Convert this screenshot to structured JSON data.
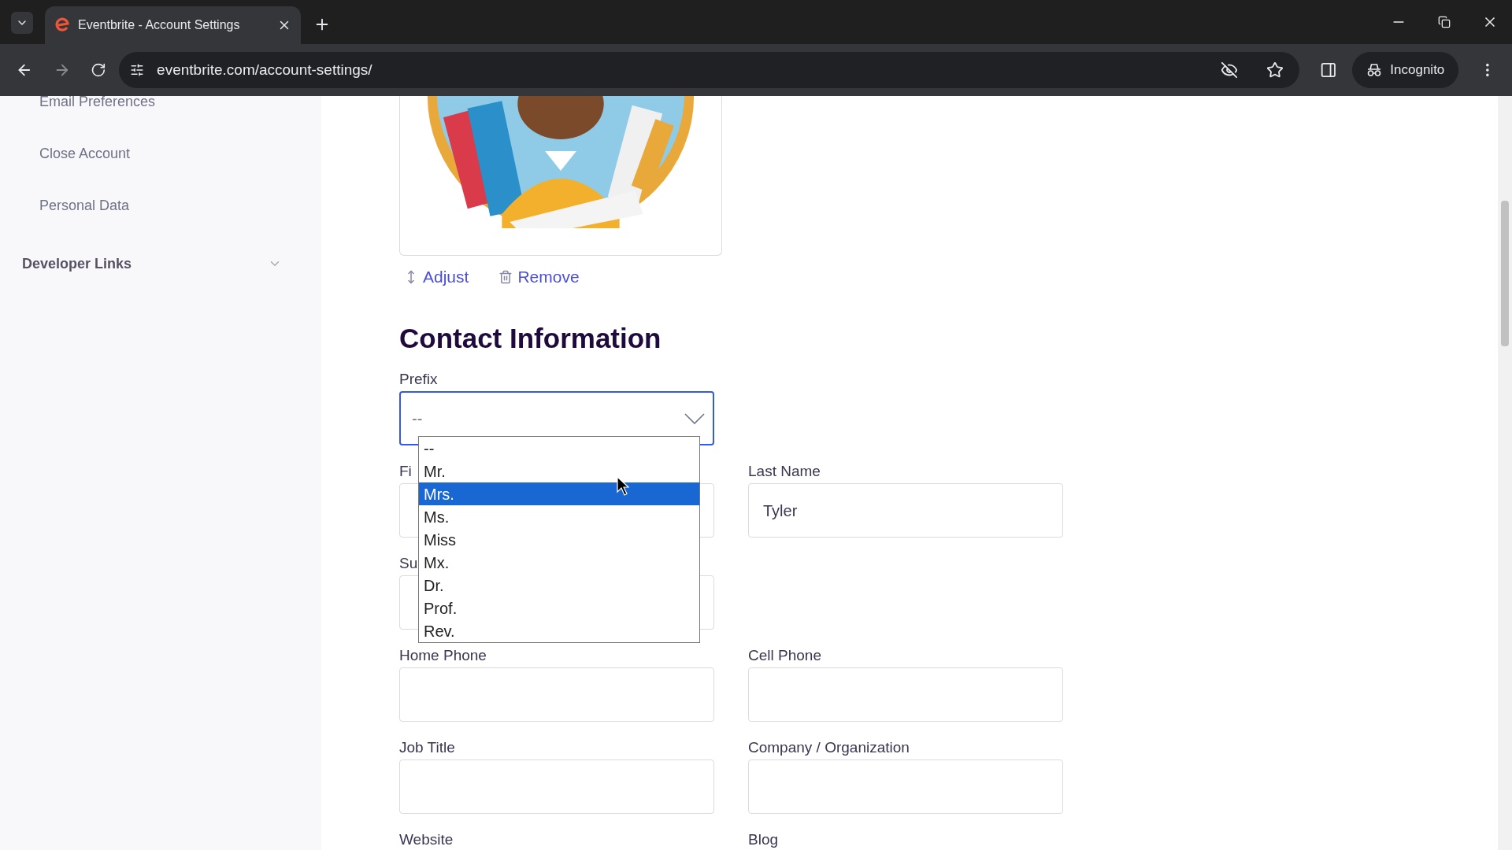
{
  "browser": {
    "tab_title": "Eventbrite - Account Settings",
    "url": "eventbrite.com/account-settings/",
    "profile_label": "Incognito"
  },
  "sidebar": {
    "items": [
      {
        "label": "Email Preferences",
        "kind": "link"
      },
      {
        "label": "Close Account",
        "kind": "link"
      },
      {
        "label": "Personal Data",
        "kind": "link"
      },
      {
        "label": "Developer Links",
        "kind": "section",
        "expanded": false
      }
    ]
  },
  "profile_photo": {
    "kind": "picture",
    "actions": [
      {
        "label": "Adjust",
        "kind": "adjust"
      },
      {
        "label": "Remove",
        "kind": "remove"
      }
    ]
  },
  "contact": {
    "heading": "Contact Information",
    "prefix": {
      "label": "Prefix",
      "value": "--",
      "open": true,
      "options": [
        {
          "label": "--",
          "highlighted": false
        },
        {
          "label": "Mr.",
          "highlighted": false
        },
        {
          "label": "Mrs.",
          "highlighted": true
        },
        {
          "label": "Ms.",
          "highlighted": false
        },
        {
          "label": "Miss",
          "highlighted": false
        },
        {
          "label": "Mx.",
          "highlighted": false
        },
        {
          "label": "Dr.",
          "highlighted": false
        },
        {
          "label": "Prof.",
          "highlighted": false
        },
        {
          "label": "Rev.",
          "highlighted": false
        }
      ]
    },
    "rows": [
      [
        {
          "label": "Fi",
          "kind": "input"
        },
        {
          "label": "Last Name",
          "kind": "input",
          "value": "Tyler"
        }
      ],
      [
        {
          "label": "Su",
          "kind": "input"
        }
      ],
      [
        {
          "label": "Home Phone",
          "kind": "input"
        },
        {
          "label": "Cell Phone",
          "kind": "input"
        }
      ],
      [
        {
          "label": "Job Title",
          "kind": "input"
        },
        {
          "label": "Company / Organization",
          "kind": "input"
        }
      ],
      [
        {
          "label": "Website",
          "kind": "label"
        },
        {
          "label": "Blog",
          "kind": "label"
        }
      ]
    ]
  }
}
